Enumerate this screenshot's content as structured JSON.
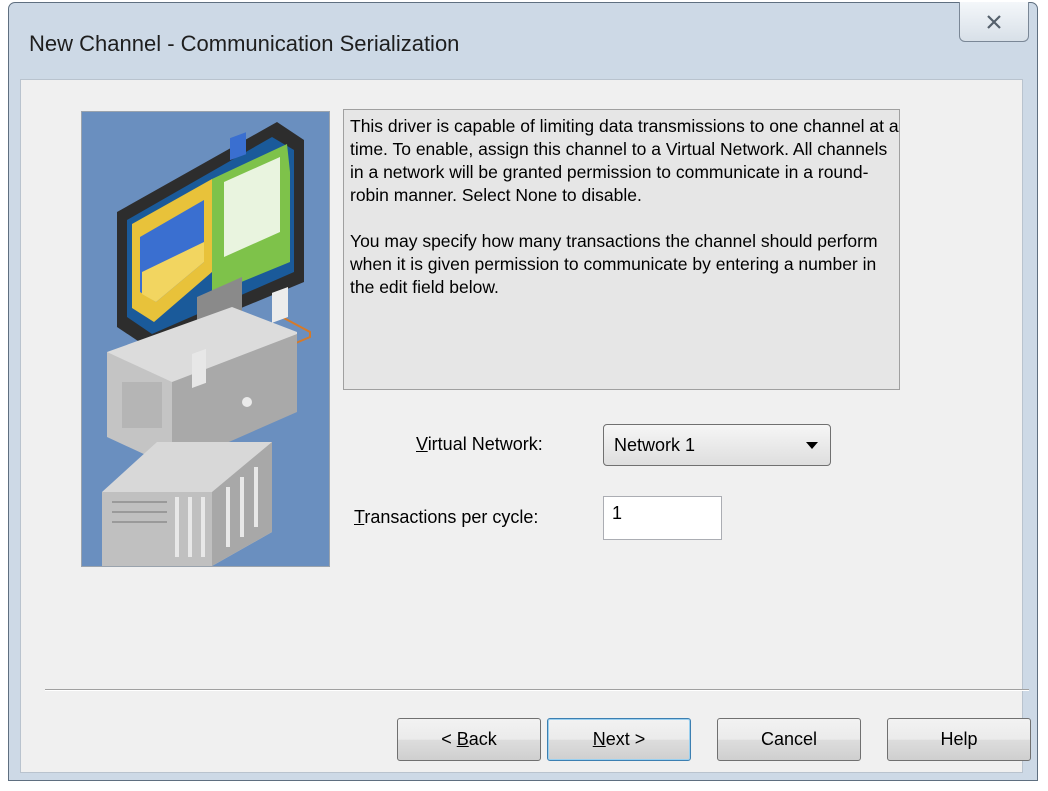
{
  "window": {
    "title": "New Channel - Communication Serialization",
    "close_icon": "close-icon"
  },
  "description": {
    "paragraph1": "This driver is capable of limiting data transmissions to one channel at a time. To enable, assign this channel to a Virtual Network. All channels in a network will be granted permission to communicate in a round-robin manner. Select None to disable.",
    "paragraph2": "You may specify how many transactions the channel should perform when it is given permission to communicate by entering a number in the edit field below."
  },
  "fields": {
    "virtual_network": {
      "label_first": "V",
      "label_rest": "irtual Network:",
      "value": "Network 1"
    },
    "transactions_per_cycle": {
      "label_first": "T",
      "label_rest": "ransactions per cycle:",
      "value": "1"
    }
  },
  "buttons": {
    "back": {
      "prefix": "< ",
      "mnemonic": "B",
      "rest": "ack"
    },
    "next": {
      "mnemonic": "N",
      "rest": "ext >"
    },
    "cancel": "Cancel",
    "help": "Help"
  },
  "colors": {
    "illustration_bg": "#6a8fbf",
    "connector": "#d47a2a"
  }
}
